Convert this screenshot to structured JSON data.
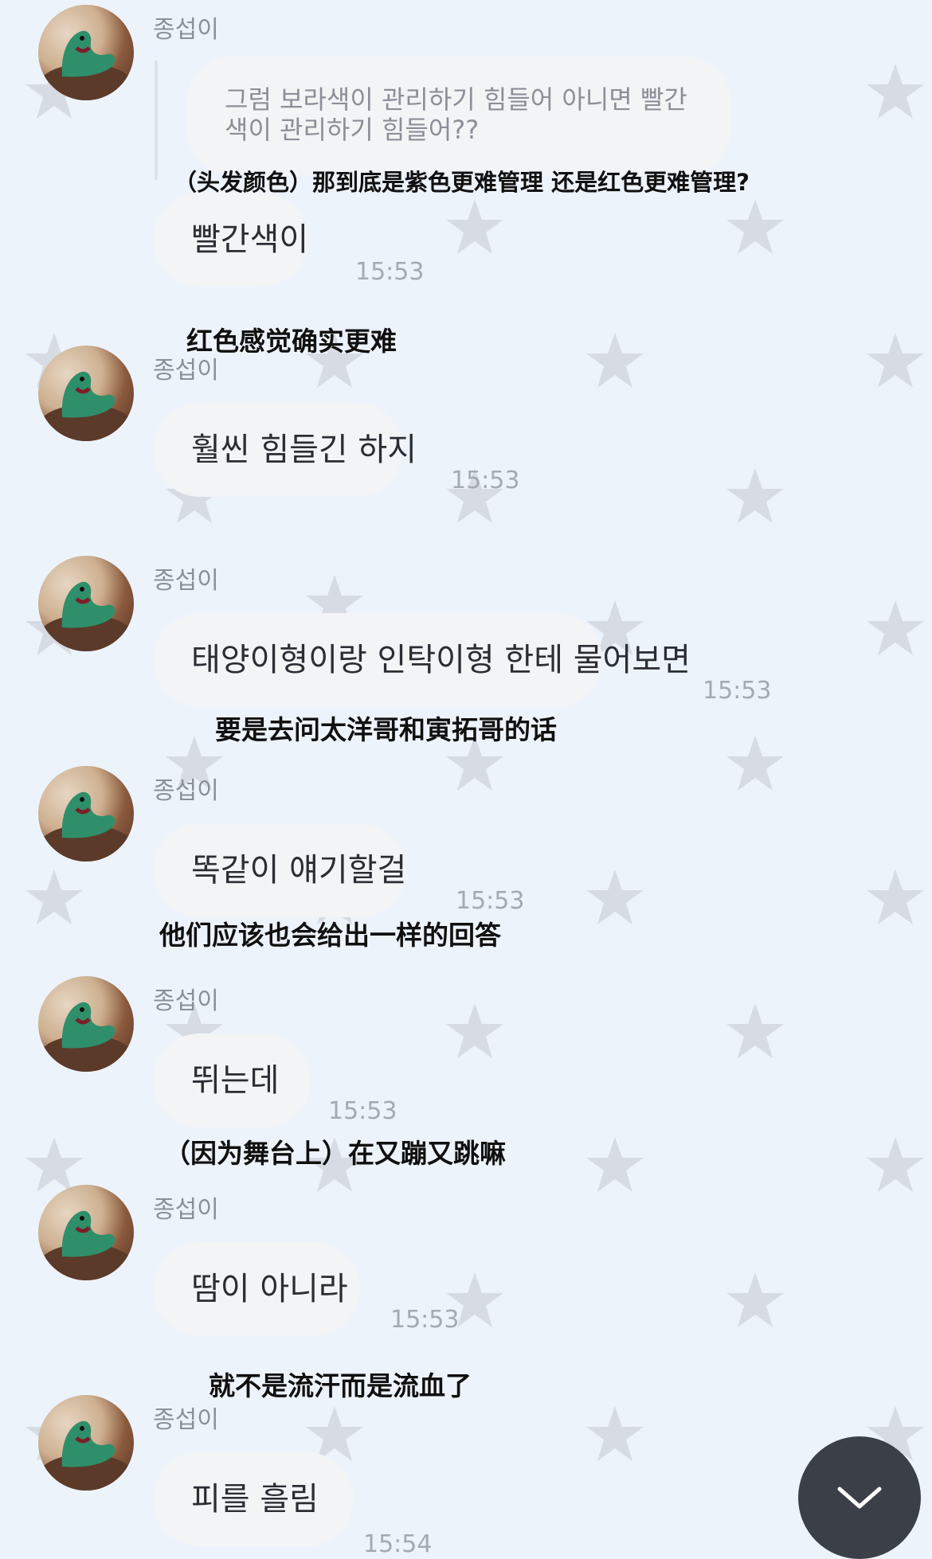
{
  "sender_name": "종섭이",
  "quoted_message": {
    "text": "그럼 보라색이 관리하기 힘들어 아니면 빨간색이 관리하기 힘들어??"
  },
  "messages": [
    {
      "text": "빨간색이",
      "time": "15:53",
      "translation_above": "（头发颜色）那到底是紫色更难管理 还是红色更难管理?",
      "translation_below": "红色感觉确实更难"
    },
    {
      "text": "훨씬 힘들긴 하지",
      "time": "15:53"
    },
    {
      "text": "태양이형이랑 인탁이형 한테 물어보면",
      "time": "15:53",
      "translation_below": "要是去问太洋哥和寅拓哥的话"
    },
    {
      "text": "똑같이 얘기할걸",
      "time": "15:53",
      "translation_below": "他们应该也会给出一样的回答"
    },
    {
      "text": "뛰는데",
      "time": "15:53",
      "translation_below": "（因为舞台上）在又蹦又跳嘛"
    },
    {
      "text": "땀이 아니라",
      "time": "15:53",
      "translation_below": "就不是流汗而是流血了"
    },
    {
      "text": "피를 흘림",
      "time": "15:54"
    }
  ],
  "icons": {
    "avatar": "lizard-avatar-icon",
    "scroll_down": "chevron-down-icon",
    "background": "star-pattern-icon"
  },
  "colors": {
    "background": "#edf3fb",
    "bubble": "#f3f4f6",
    "scroll_button": "#3b4048",
    "star": "#d6dbe4"
  }
}
